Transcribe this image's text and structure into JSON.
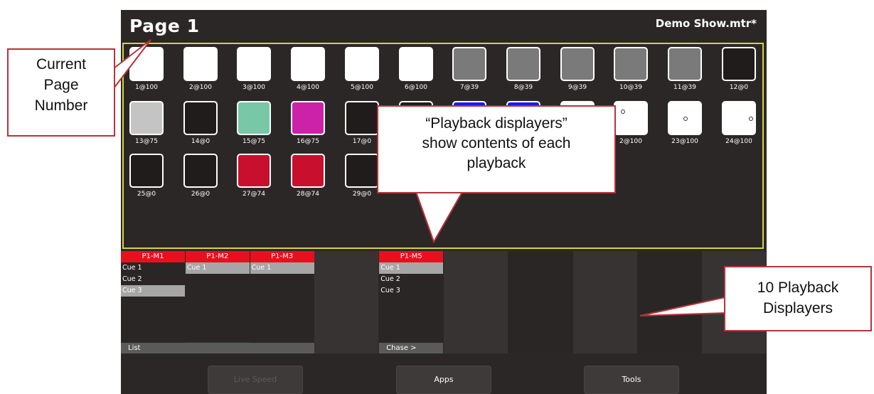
{
  "screen": {
    "page_title": "Page 1",
    "show_name": "Demo Show.mtr*"
  },
  "fixtures": [
    {
      "label": "1@100",
      "color": "#ffffff"
    },
    {
      "label": "2@100",
      "color": "#ffffff"
    },
    {
      "label": "3@100",
      "color": "#ffffff"
    },
    {
      "label": "4@100",
      "color": "#ffffff"
    },
    {
      "label": "5@100",
      "color": "#ffffff"
    },
    {
      "label": "6@100",
      "color": "#ffffff"
    },
    {
      "label": "7@39",
      "color": "#7a7a7a"
    },
    {
      "label": "8@39",
      "color": "#7a7a7a"
    },
    {
      "label": "9@39",
      "color": "#7a7a7a"
    },
    {
      "label": "10@39",
      "color": "#7a7a7a"
    },
    {
      "label": "11@39",
      "color": "#7a7a7a"
    },
    {
      "label": "12@0",
      "color": "#201c1c"
    },
    {
      "label": "13@75",
      "color": "#c4c4c4"
    },
    {
      "label": "14@0",
      "color": "#201c1c"
    },
    {
      "label": "15@75",
      "color": "#78c8a8"
    },
    {
      "label": "16@75",
      "color": "#cc22aa"
    },
    {
      "label": "17@0",
      "color": "#201c1c"
    },
    {
      "label": "",
      "color": "#201c1c"
    },
    {
      "label": "",
      "color": "#1a1aee"
    },
    {
      "label": "",
      "color": "#1a1aee"
    },
    {
      "label": "",
      "color": "#ffffff"
    },
    {
      "label": "2@100",
      "color": "#ffffff",
      "dot": "left"
    },
    {
      "label": "23@100",
      "color": "#ffffff",
      "dot": "center"
    },
    {
      "label": "24@100",
      "color": "#ffffff",
      "dot": "right"
    },
    {
      "label": "25@0",
      "color": "#201c1c"
    },
    {
      "label": "26@0",
      "color": "#201c1c"
    },
    {
      "label": "27@74",
      "color": "#c8102e"
    },
    {
      "label": "28@74",
      "color": "#c8102e"
    },
    {
      "label": "29@0",
      "color": "#201c1c"
    }
  ],
  "playbacks": [
    {
      "title": "P1-M1",
      "cues": [
        "Cue 1",
        "Cue 2",
        "Cue 3"
      ],
      "active_cue": 2,
      "mode": "List"
    },
    {
      "title": "P1-M2",
      "cues": [
        "Cue 1"
      ],
      "active_cue": 0,
      "mode": ""
    },
    {
      "title": "P1-M3",
      "cues": [
        "Cue 1"
      ],
      "active_cue": 0,
      "mode": ""
    },
    {
      "title": "",
      "cues": [],
      "mode": ""
    },
    {
      "title": "P1-M5",
      "cues": [
        "Cue 1",
        "Cue 2",
        "Cue 3"
      ],
      "active_cue": 0,
      "mode": "Chase >"
    },
    {
      "title": "",
      "cues": [],
      "mode": ""
    },
    {
      "title": "",
      "cues": [],
      "mode": ""
    },
    {
      "title": "",
      "cues": [],
      "mode": ""
    },
    {
      "title": "",
      "cues": [],
      "mode": ""
    },
    {
      "title": "",
      "cues": [],
      "mode": ""
    }
  ],
  "toolbar": {
    "live_speed_label": "Live Speed",
    "apps_label": "Apps",
    "tools_label": "Tools"
  },
  "annotations": {
    "current_page_number": [
      "Current",
      "Page",
      "Number"
    ],
    "playback_displayers_info": [
      "“Playback displayers”",
      "show contents of each",
      "playback"
    ],
    "ten_playback_displayers": [
      "10 Playback",
      "Displayers"
    ]
  },
  "colors": {
    "screen_bg": "#2b2727",
    "grid_border": "#d4d43a",
    "playback_header": "#e8101e",
    "displayer_bg_a": "#2a2626",
    "displayer_bg_b": "#373333",
    "callout_border": "#b8323a"
  }
}
